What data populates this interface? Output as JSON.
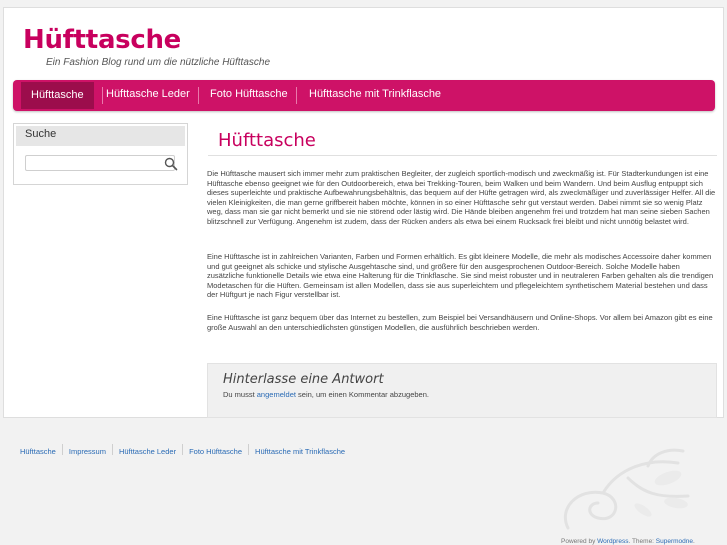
{
  "site": {
    "title": "Hüfttasche",
    "description": "Ein Fashion Blog rund um die nützliche Hüfttasche"
  },
  "nav": {
    "items": [
      {
        "label": "Hüfttasche",
        "active": true
      },
      {
        "label": "Hüfttasche Leder"
      },
      {
        "label": "Foto Hüfttasche"
      },
      {
        "label": "Hüfttasche mit Trinkflasche"
      }
    ]
  },
  "sidebar": {
    "search_title": "Suche",
    "search_value": "",
    "search_icon": "search-icon"
  },
  "post": {
    "title": "Hüfttasche",
    "paragraphs": [
      "Die Hüfttasche mausert sich immer mehr zum praktischen Begleiter, der zugleich sportlich-modisch und zweckmäßig ist. Für Stadterkundungen ist eine Hüfttasche ebenso geeignet wie für den Outdoorbereich, etwa bei Trekking-Touren, beim Walken und beim Wandern. Und beim Ausflug entpuppt sich dieses superleichte und praktische Aufbewahrungsbehältnis, das bequem auf der Hüfte getragen wird, als zweckmäßiger und zuverlässiger Helfer. All die vielen Kleinigkeiten, die man gerne griffbereit haben möchte, können in so einer Hüfttasche sehr gut verstaut werden. Dabei nimmt sie so wenig Platz weg, dass man sie gar nicht bemerkt und sie nie störend oder lästig wird. Die Hände bleiben angenehm frei und trotzdem hat man seine sieben Sachen blitzschnell zur Verfügung. Angenehm ist zudem, dass der Rücken anders als etwa bei einem Rucksack frei bleibt und nicht unnötig belastet wird.",
      "Eine Hüfttasche ist in zahlreichen Varianten, Farben und Formen erhältlich. Es gibt kleinere Modelle, die mehr als modisches Accessoire daher kommen und gut geeignet als schicke und stylische Ausgehtasche sind, und größere für den ausgesprochenen Outdoor-Bereich. Solche Modelle haben zusätzliche funktionelle Details wie etwa eine Halterung für die Trinkflasche. Sie sind meist robuster und in neutraleren Farben gehalten als die trendigen Modetaschen für die Hüften. Gemeinsam ist allen Modellen, dass sie aus superleichtem und pflegeleichtem synthetischem Material bestehen und dass der Hüftgurt je nach Figur verstellbar ist.",
      "Eine Hüfttasche ist ganz bequem über das Internet zu bestellen, zum Beispiel bei Versandhäusern und Online-Shops. Vor allem bei Amazon gibt es eine große Auswahl an den unterschiedlichsten günstigen Modellen, die ausführlich beschrieben werden."
    ]
  },
  "comments": {
    "heading": "Hinterlasse eine Antwort",
    "text_before": "Du musst ",
    "login_link": "angemeldet",
    "text_after": " sein, um einen Kommentar abzugeben."
  },
  "footer": {
    "links": [
      "Hüfttasche",
      "Impressum",
      "Hüfttasche Leder",
      "Foto Hüfttasche",
      "Hüfttasche mit Trinkflasche"
    ],
    "credits_prefix": "Powered by ",
    "credits_wordpress": "Wordpress",
    "credits_mid": ". Theme: ",
    "credits_theme": "Supermodne",
    "credits_suffix": "."
  },
  "colors": {
    "brand": "#c8005e",
    "nav_bg": "#ce1267",
    "nav_active": "#9c0d4c",
    "link": "#2a6bb5"
  }
}
